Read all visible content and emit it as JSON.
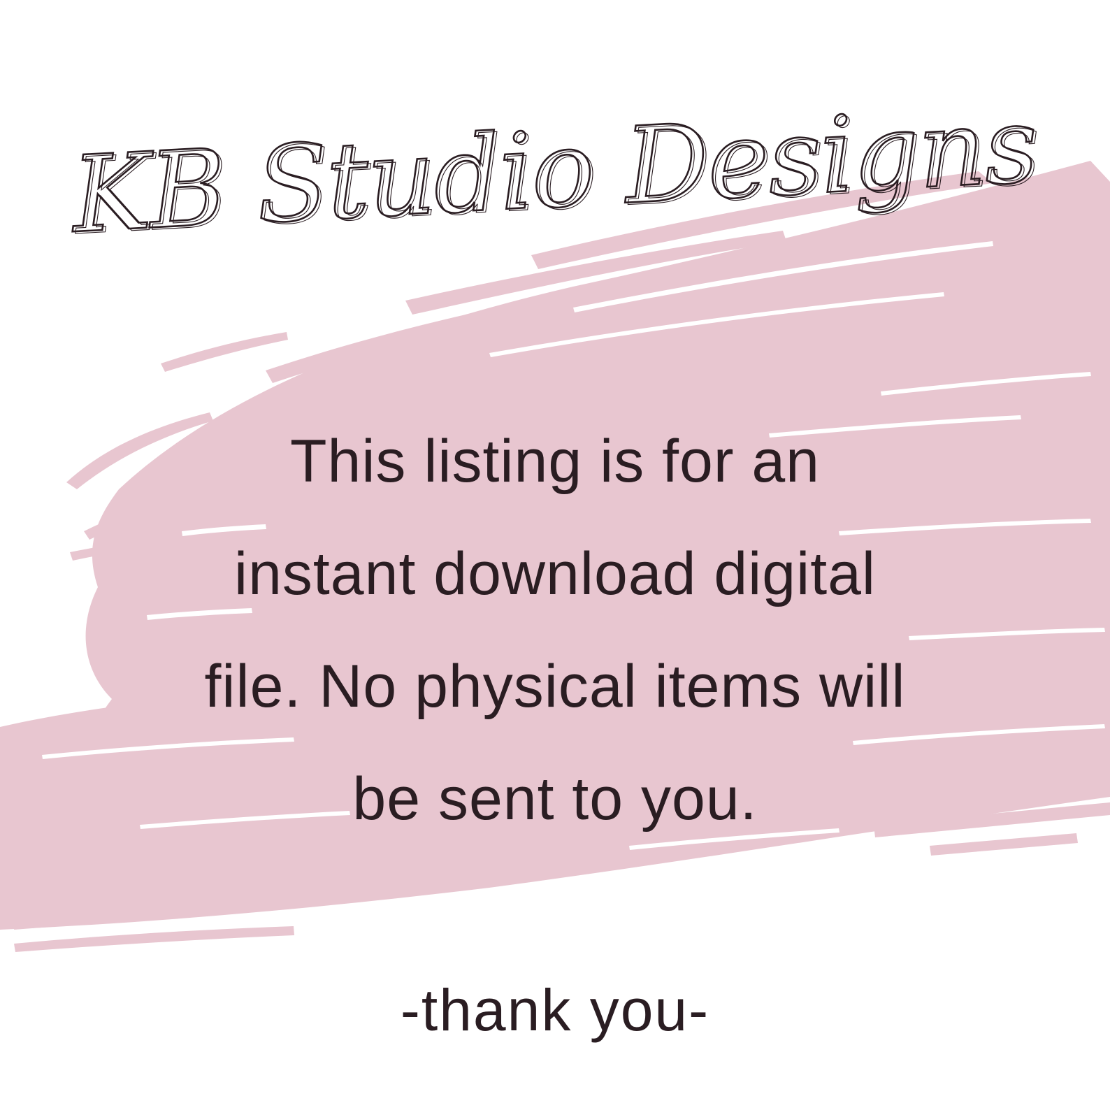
{
  "brand": {
    "logo_text": "KB Studio Designs",
    "accent_color": "#e8c6d0",
    "ink_color": "#2a1d22"
  },
  "message": {
    "lines": [
      "This listing is for an",
      "instant download digital",
      "file.  No physical items will",
      "be sent to you."
    ]
  },
  "signoff": "-thank you-"
}
